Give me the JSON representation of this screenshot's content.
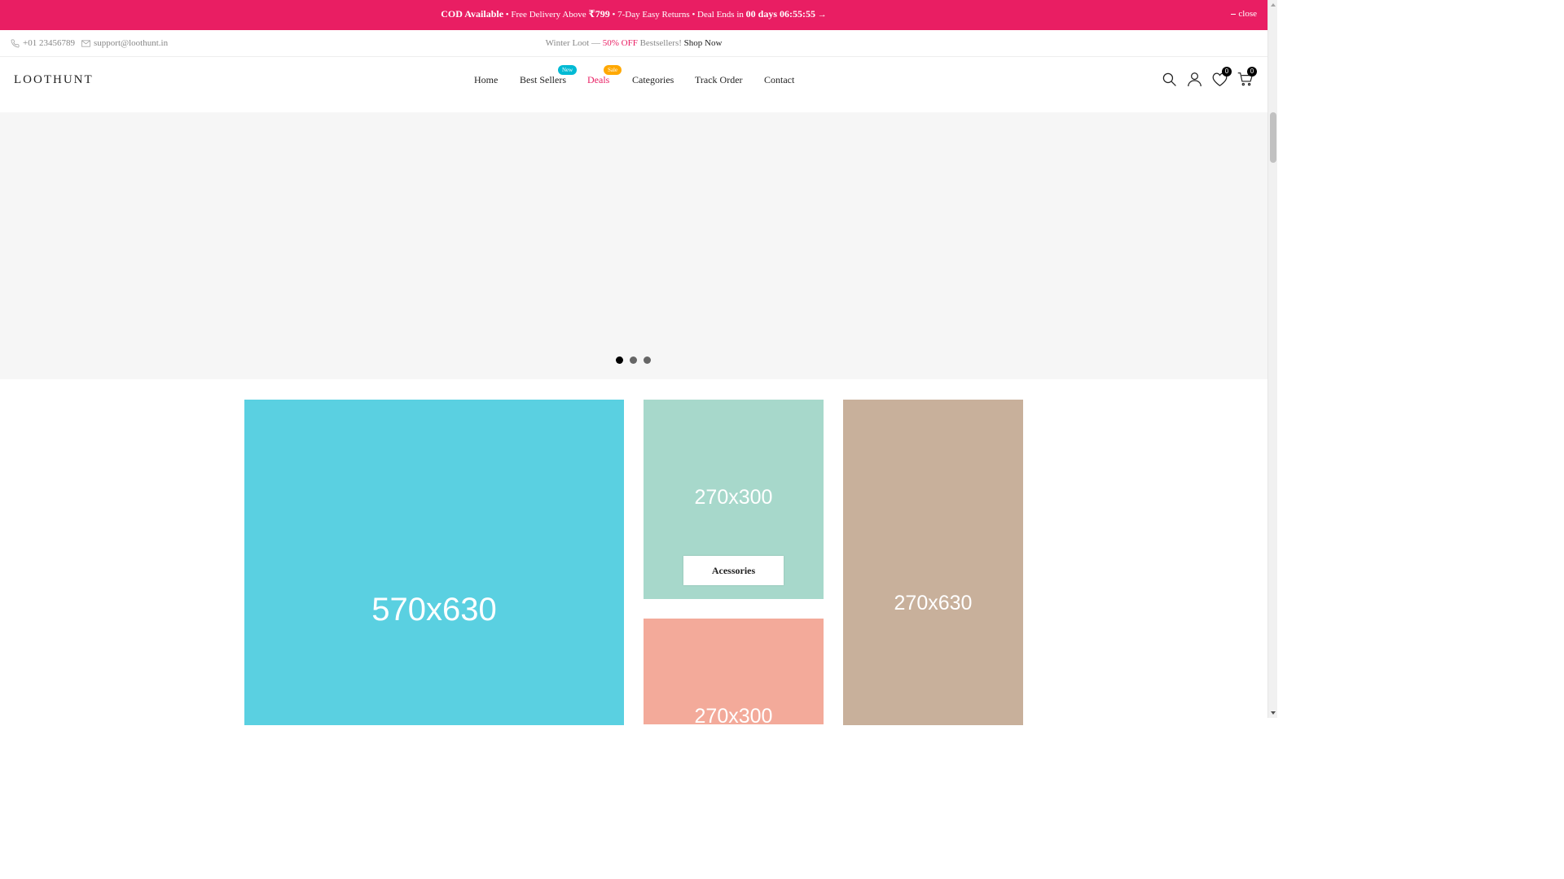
{
  "announcement": {
    "cod": "COD Available",
    "sep1": " • Free Delivery Above ",
    "price": "₹799",
    "sep2": " • 7-Day Easy Returns • Deal Ends in ",
    "countdown": "00 days 06:55:55",
    "arrow": " →",
    "close_label": "close"
  },
  "topbar": {
    "phone": "+01 23456789",
    "email": "support@loothunt.in",
    "promo_prefix": "Winter Loot — ",
    "promo_highlight": "50% OFF",
    "promo_suffix": " Bestsellers! ",
    "promo_link": "Shop Now"
  },
  "header": {
    "logo": "LOOTHUNT",
    "nav": [
      {
        "label": "Home"
      },
      {
        "label": "Best Sellers",
        "badge": "New"
      },
      {
        "label": "Deals",
        "badge": "Sale"
      },
      {
        "label": "Categories"
      },
      {
        "label": "Track Order"
      },
      {
        "label": "Contact"
      }
    ],
    "wishlist_count": "0",
    "cart_count": "0",
    "icons": [
      "search-icon",
      "user-icon",
      "heart-icon",
      "cart-icon"
    ]
  },
  "slider": {
    "slides": 3,
    "active_slide": 1
  },
  "banners": {
    "large": "570x630",
    "top_small": "270x300",
    "top_small_button": "Acessories",
    "bottom_small": "270x300",
    "tall": "270x630"
  },
  "colors": {
    "announcement_bg": "#e91e63",
    "deals_accent": "#e91e63",
    "new_badge": "#01bad4",
    "sale_badge": "#ffa800"
  }
}
